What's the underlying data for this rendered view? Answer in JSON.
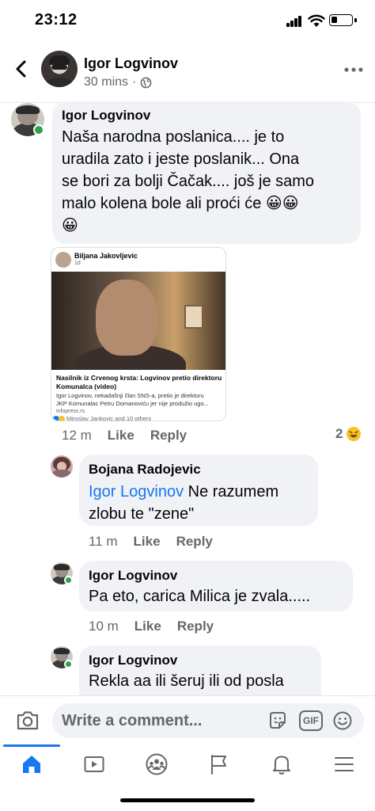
{
  "status_bar": {
    "time": "23:12"
  },
  "header": {
    "name": "Igor Logvinov",
    "time": "30 mins",
    "separator": "·",
    "icons": [
      "back-chevron-icon",
      "globe-icon",
      "more-options-icon"
    ]
  },
  "post_comment": {
    "author": "Igor Logvinov",
    "text_line1": "Naša narodna poslanica.... je to",
    "text_line2": "uradila  zato i jeste poslanik... Ona",
    "text_line3": "se bori za bolji Čačak.... još je samo",
    "text_line4": "malo kolena  bole ali proći će 😀😀",
    "text_line5": "😀",
    "shared": {
      "author": "Biljana Jakovljevic",
      "time": "1d ·",
      "headline": "Nasilnik iz Crvenog krsta: Logvinov pretio direktoru Komunalca (video)",
      "desc_line1": "Igor Logvinov, nekadašnji član SNS-a, pretio je direktoru",
      "desc_line2": "JKP Komunalac Petru Domanoviću jer nije produžio ugo...",
      "domain": "infopress.rs",
      "reactions": "Miroslav Jankovic and 10 others"
    },
    "time": "12 m",
    "like": "Like",
    "reply": "Reply",
    "reaction_count": "2"
  },
  "replies": [
    {
      "author": "Bojana Radojevic",
      "mention": "Igor Logvinov",
      "text_a": " Ne razumem",
      "text_b": "zlobu te \"zene\"",
      "time": "11 m",
      "like": "Like",
      "reply": "Reply"
    },
    {
      "author": "Igor Logvinov",
      "text": "Pa eto, carica Milica je zvala.....",
      "time": "10 m",
      "like": "Like",
      "reply": "Reply"
    },
    {
      "author": "Igor Logvinov",
      "text_a": "Rekla aa ili šeruj ili od posla",
      "text_b": ""
    }
  ],
  "composer": {
    "placeholder": "Write a comment...",
    "gif_label": "GIF",
    "icons": [
      "camera-icon",
      "sticker-icon",
      "gif-icon",
      "emoji-icon"
    ]
  },
  "tabs": [
    "home-icon",
    "watch-icon",
    "groups-icon",
    "pages-flag-icon",
    "notifications-bell-icon",
    "menu-icon"
  ],
  "colors": {
    "accent": "#1877f2",
    "bubble": "#f0f2f5",
    "online": "#31a24c",
    "meta_text": "#65676b"
  }
}
